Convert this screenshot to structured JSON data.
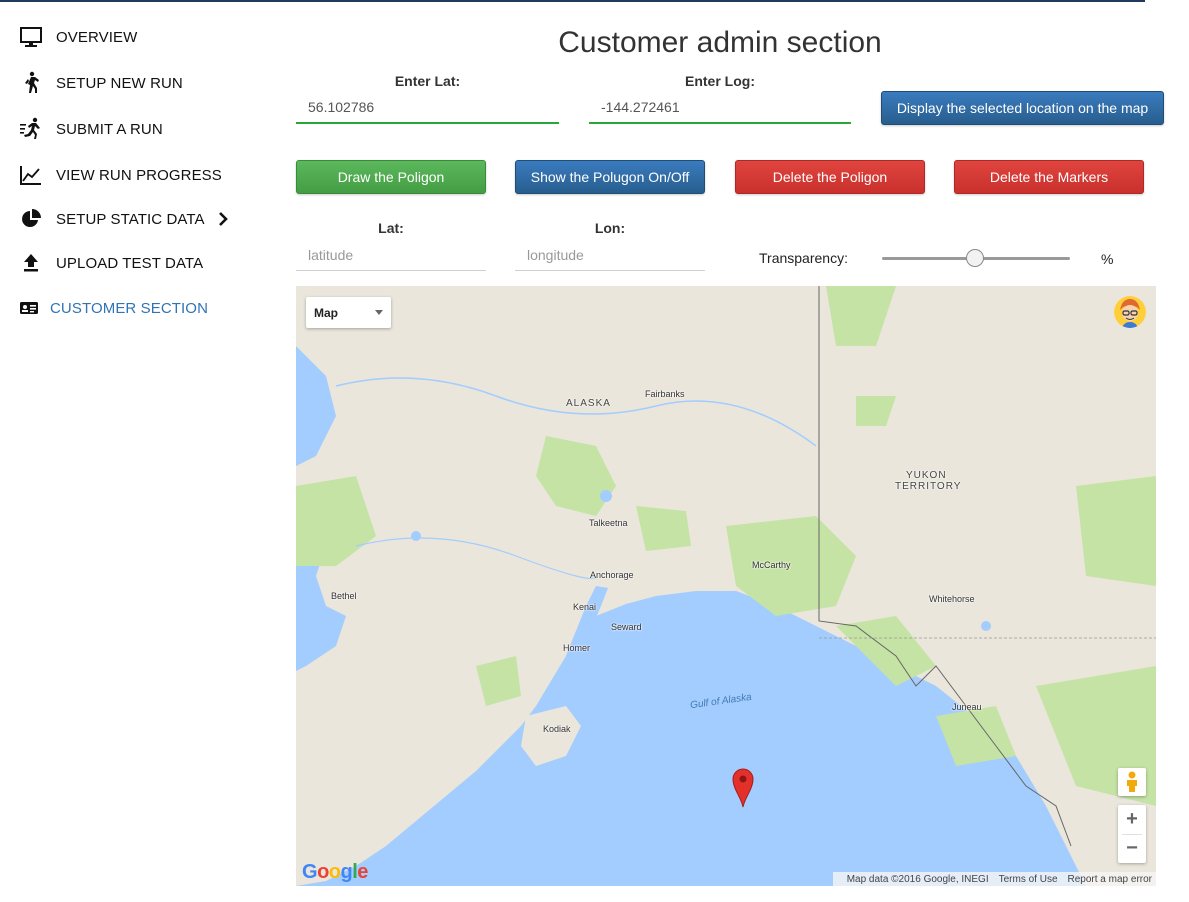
{
  "sidebar": {
    "items": [
      {
        "label": "OVERVIEW",
        "icon": "monitor-icon"
      },
      {
        "label": "SETUP NEW RUN",
        "icon": "walking-person-icon"
      },
      {
        "label": "SUBMIT A RUN",
        "icon": "running-person-icon"
      },
      {
        "label": "VIEW RUN PROGRESS",
        "icon": "line-chart-icon"
      },
      {
        "label": "SETUP STATIC DATA",
        "icon": "pie-chart-icon"
      },
      {
        "label": "UPLOAD TEST DATA",
        "icon": "upload-icon"
      },
      {
        "label": "CUSTOMER SECTION",
        "icon": "id-card-icon",
        "active": true
      }
    ]
  },
  "header": {
    "title": "Customer admin section"
  },
  "location_form": {
    "lat_label": "Enter Lat:",
    "lat_value": "56.102786",
    "log_label": "Enter Log:",
    "log_value": "-144.272461",
    "display_button": "Display the selected location on the map"
  },
  "actions": {
    "draw_polygon": "Draw the Poligon",
    "toggle_polygon": "Show the Polugon On/Off",
    "delete_polygon": "Delete the Poligon",
    "delete_markers": "Delete the Markers"
  },
  "coords": {
    "lat_label": "Lat:",
    "lat_placeholder": "latitude",
    "lon_label": "Lon:",
    "lon_placeholder": "longitude",
    "transparency_label": "Transparency:",
    "transparency_unit": "%",
    "transparency_level_percent": 50
  },
  "map": {
    "type_selected": "Map",
    "places": {
      "alaska": "ALASKA",
      "fairbanks": "Fairbanks",
      "yukon": "YUKON",
      "territory": "TERRITORY",
      "talkeetna": "Talkeetna",
      "mccarthy": "McCarthy",
      "anchorage": "Anchorage",
      "bethel": "Bethel",
      "kenai": "Kenai",
      "whitehorse": "Whitehorse",
      "seward": "Seward",
      "homer": "Homer",
      "gulf": "Gulf of Alaska",
      "juneau": "Juneau",
      "kodiak": "Kodiak"
    },
    "attribution": "Map data ©2016 Google, INEGI",
    "terms": "Terms of Use",
    "report": "Report a map error",
    "logo": "Google",
    "zoom_in": "+",
    "zoom_out": "−",
    "colors": {
      "water": "#a3ccff",
      "land": "#eae6dc",
      "park": "#c5e3a5"
    }
  }
}
